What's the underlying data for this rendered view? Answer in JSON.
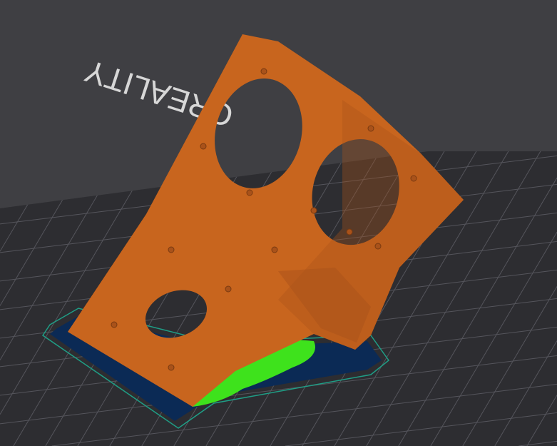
{
  "viewport": {
    "bed_logo": "CREALITY",
    "colors": {
      "background": "#3f3f43",
      "bed": "#2d2d31",
      "grid": "#55555c",
      "model": "#c8651e",
      "model_dark": "#a9521a",
      "support": "#3ee21c",
      "brim": "#0b2a55",
      "skirt": "#1f9e86"
    }
  }
}
